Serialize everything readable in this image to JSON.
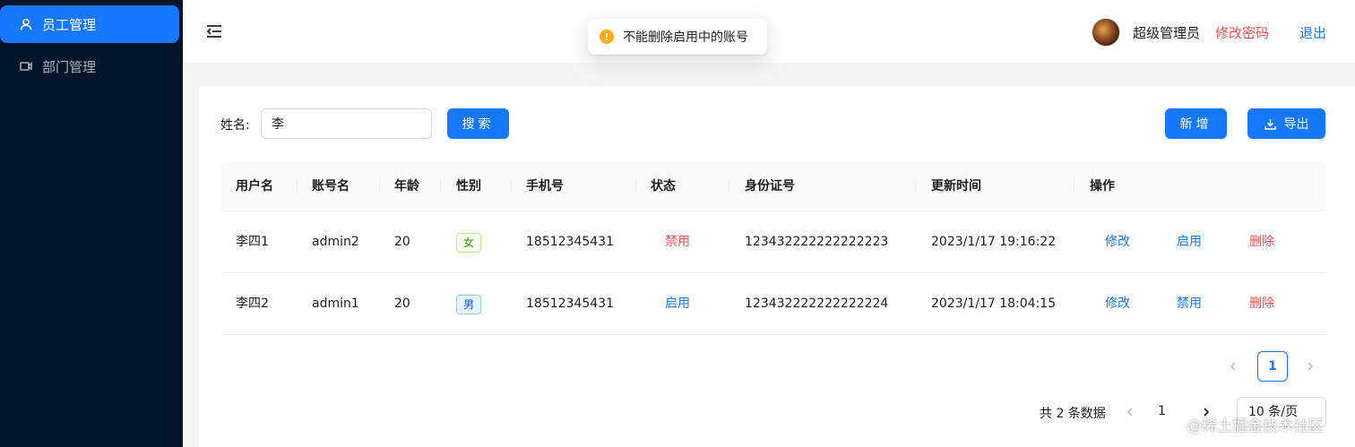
{
  "sidebar": {
    "items": [
      {
        "label": "员工管理",
        "icon": "user-icon",
        "active": true
      },
      {
        "label": "部门管理",
        "icon": "video-camera-icon",
        "active": false
      }
    ]
  },
  "header": {
    "username": "超级管理员",
    "change_password": "修改密码",
    "logout": "退出"
  },
  "toast": {
    "type": "warning",
    "icon": "!",
    "message": "不能删除启用中的账号"
  },
  "search": {
    "label": "姓名:",
    "value": "李",
    "button": "搜索"
  },
  "toolbar": {
    "add_label": "新增",
    "export_label": "导出"
  },
  "table": {
    "columns": [
      "用户名",
      "账号名",
      "年龄",
      "性别",
      "手机号",
      "状态",
      "身份证号",
      "更新时间",
      "操作"
    ],
    "rows": [
      {
        "username": "李四1",
        "account": "admin2",
        "age": "20",
        "gender": "女",
        "phone": "18512345431",
        "status": "禁用",
        "id_number": "123432222222222223",
        "updated": "2023/1/17 19:16:22",
        "action_edit": "修改",
        "action_toggle": "启用",
        "action_delete": "删除"
      },
      {
        "username": "李四2",
        "account": "admin1",
        "age": "20",
        "gender": "男",
        "phone": "18512345431",
        "status": "启用",
        "id_number": "123432222222222224",
        "updated": "2023/1/17 18:04:15",
        "action_edit": "修改",
        "action_toggle": "禁用",
        "action_delete": "删除"
      }
    ]
  },
  "pagination": {
    "current_page": "1",
    "total_text": "共 2 条数据",
    "page_number": "1",
    "page_size": "10 条/页"
  },
  "watermark": "@稀土掘金技术社区",
  "colors": {
    "sidebar_bg": "#001529",
    "primary": "#1677ff",
    "danger": "#ff4d4f",
    "warning": "#faad14"
  }
}
